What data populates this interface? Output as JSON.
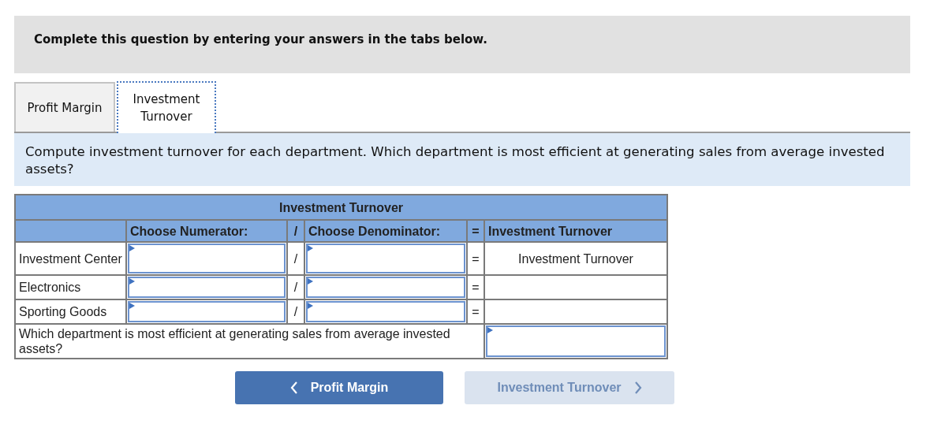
{
  "header": {
    "text": "Complete this question by entering your answers in the tabs below."
  },
  "tabs": [
    {
      "label": "Profit Margin",
      "selected": false
    },
    {
      "label": "Investment Turnover",
      "selected": true
    }
  ],
  "instruction": "Compute investment turnover for each department. Which department is most efficient at generating sales from average invested assets?",
  "table": {
    "title": "Investment Turnover",
    "columns": [
      "Choose Numerator:",
      "/",
      "Choose Denominator:",
      "=",
      "Investment Turnover"
    ],
    "rows": [
      {
        "label": "Investment Center",
        "divide": "/",
        "equals": "=",
        "result": "Investment Turnover"
      },
      {
        "label": "Electronics",
        "divide": "/",
        "equals": "="
      },
      {
        "label": "Sporting Goods",
        "divide": "/",
        "equals": "="
      }
    ],
    "question": "Which department is most efficient at generating sales from average invested assets?"
  },
  "nav_buttons": [
    {
      "label": "Profit Margin",
      "kind": "previous",
      "disabled": false
    },
    {
      "label": "Investment Turnover",
      "kind": "next",
      "disabled": true
    }
  ]
}
